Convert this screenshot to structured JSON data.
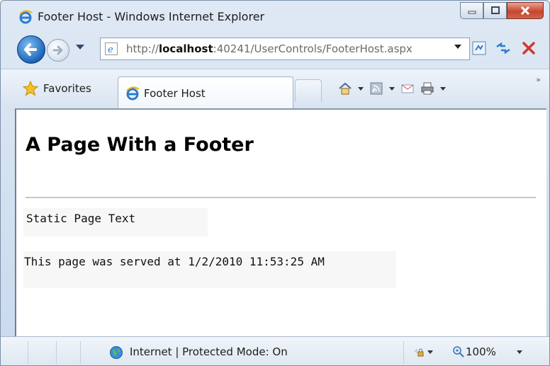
{
  "window": {
    "title": "Footer Host - Windows Internet Explorer"
  },
  "address_bar": {
    "url_prefix": "http://",
    "url_host": "localhost",
    "url_rest": ":40241/UserControls/FooterHost.aspx"
  },
  "favorites_bar": {
    "favorites_label": "Favorites",
    "tab_label": "Footer Host",
    "more_chevrons": "»"
  },
  "page": {
    "heading": "A Page With a Footer",
    "static_text": "Static Page Text",
    "footer_text": "This page was served at 1/2/2010 11:53:25 AM"
  },
  "status_bar": {
    "zone_text": "Internet | Protected Mode: On",
    "zoom_text": "100%"
  },
  "colors": {
    "accent_blue": "#1d64b9",
    "close_red": "#c7452f"
  }
}
